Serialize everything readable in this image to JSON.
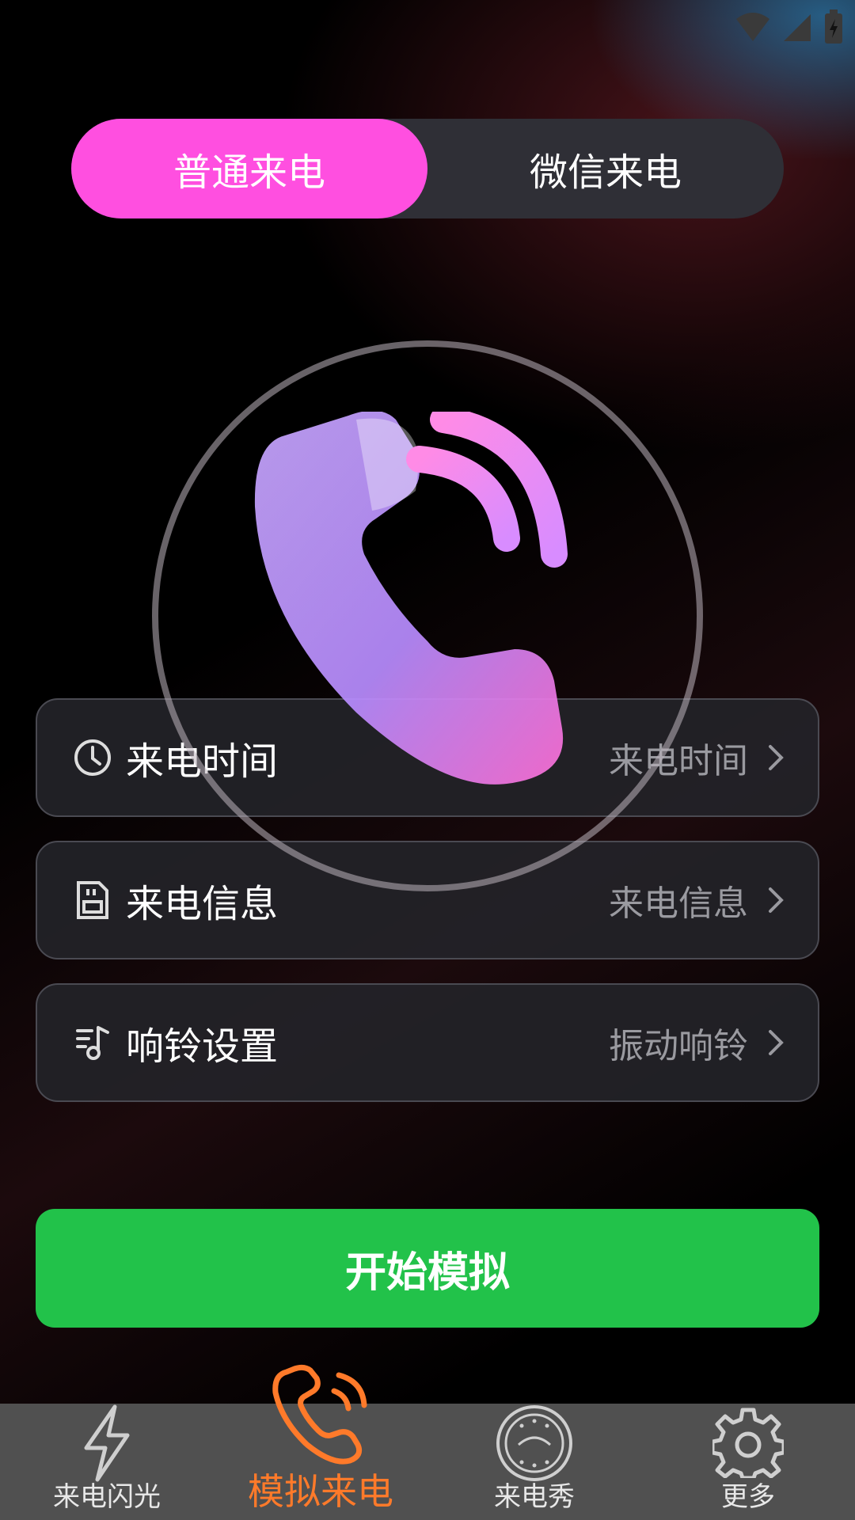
{
  "status_bar": {
    "icons": [
      "wifi-icon",
      "signal-icon",
      "battery-icon"
    ]
  },
  "segment": {
    "tabs": [
      {
        "label": "普通来电",
        "active": true
      },
      {
        "label": "微信来电",
        "active": false
      }
    ],
    "active_color": "#ff4fe0"
  },
  "hero": {
    "icon": "phone-ringing-icon"
  },
  "rows": [
    {
      "icon": "clock-icon",
      "label": "来电时间",
      "value": "来电时间"
    },
    {
      "icon": "sim-card-icon",
      "label": "来电信息",
      "value": "来电信息"
    },
    {
      "icon": "music-note-icon",
      "label": "响铃设置",
      "value": "振动响铃"
    }
  ],
  "start_button": {
    "label": "开始模拟",
    "color": "#22c24a"
  },
  "bottom_nav": {
    "items": [
      {
        "icon": "lightning-icon",
        "label": "来电闪光",
        "active": false
      },
      {
        "icon": "phone-ringing-icon",
        "label": "模拟来电",
        "active": true
      },
      {
        "icon": "badge-icon",
        "label": "来电秀",
        "active": false
      },
      {
        "icon": "gear-icon",
        "label": "更多",
        "active": false
      }
    ],
    "active_color": "#ff7a2a"
  }
}
